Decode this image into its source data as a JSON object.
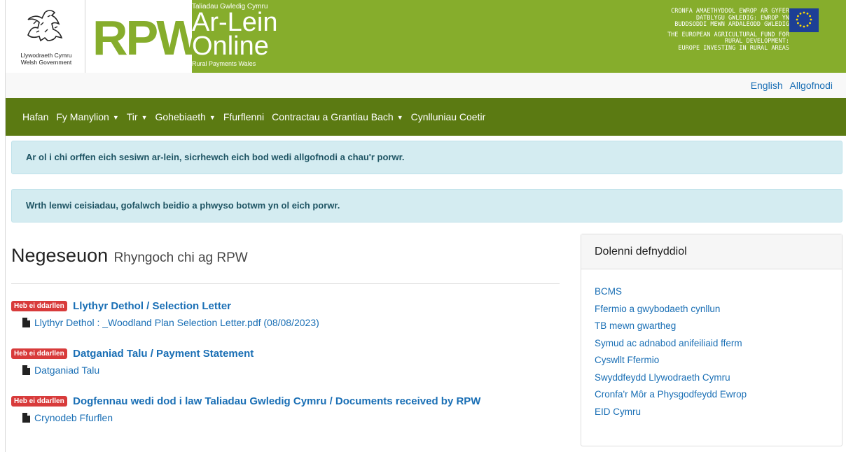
{
  "banner": {
    "wg_line1": "Llywodraeth Cymru",
    "wg_line2": "Welsh Government",
    "rpw": "RPW",
    "online_small": "Taliadau Gwledig Cymru",
    "online_line1": "Ar-Lein",
    "online_line2": "Online",
    "online_foot": "Rural Payments Wales",
    "eu_cy": [
      "CRONFA AMAETHYDDOL EWROP AR GYFER",
      "DATBLYGU GWLEDIG: EWROP YN",
      "BUDDSODDI MEWN ARDALEODD GWLEDIG"
    ],
    "eu_en": [
      "THE EUROPEAN AGRICULTURAL FUND FOR",
      "RURAL DEVELOPMENT:",
      "EUROPE INVESTING IN RURAL AREAS"
    ]
  },
  "toplinks": {
    "english": "English",
    "logout": "Allgofnodi"
  },
  "nav": {
    "items": [
      {
        "label": "Hafan"
      },
      {
        "label": "Fy Manylion"
      },
      {
        "label": "Tir"
      },
      {
        "label": "Gohebiaeth"
      },
      {
        "label": "Ffurflenni"
      },
      {
        "label": "Contractau a Grantiau Bach"
      },
      {
        "label": "Cynlluniau Coetir"
      }
    ]
  },
  "alerts": {
    "logout_notice": "Ar ol i chi orffen eich sesiwn ar-lein, sicrhewch eich bod wedi allgofnodi a chau'r porwr.",
    "back_notice": "Wrth lenwi ceisiadau, gofalwch beidio a phwyso botwm yn ol eich porwr."
  },
  "messages": {
    "title": "Negeseuon",
    "subtitle": "Rhyngoch chi ag RPW",
    "items": [
      {
        "badge": "Heb ei ddarllen",
        "title": "Llythyr Dethol / Selection Letter",
        "file": "Llythyr Dethol : _Woodland Plan Selection Letter.pdf (08/08/2023)"
      },
      {
        "badge": "Heb ei ddarllen",
        "title": "Datganiad Talu / Payment Statement",
        "file": "Datganiad Talu"
      },
      {
        "badge": "Heb ei ddarllen",
        "title": "Dogfennau wedi dod i law Taliadau Gwledig Cymru / Documents received by RPW",
        "file": "Crynodeb Ffurflen"
      }
    ]
  },
  "sidebar": {
    "title": "Dolenni defnyddiol",
    "links": [
      "BCMS",
      "Ffermio a gwybodaeth cynllun",
      "TB mewn gwartheg",
      "Symud ac adnabod anifeiliaid fferm",
      "Cyswllt Ffermio",
      "Swyddfeydd Llywodraeth Cymru",
      "Cronfa'r Môr a Physgodfeydd Ewrop",
      "EID Cymru"
    ]
  },
  "colors": {
    "banner": "#86ad2c",
    "nav": "#5b7a12",
    "link": "#1a6fb5",
    "badge": "#d83b3b",
    "alert_bg": "#d4ecf1"
  },
  "icons": {
    "file": "file-icon",
    "logo": "welsh-dragon-icon",
    "flag": "eu-flag-icon"
  }
}
